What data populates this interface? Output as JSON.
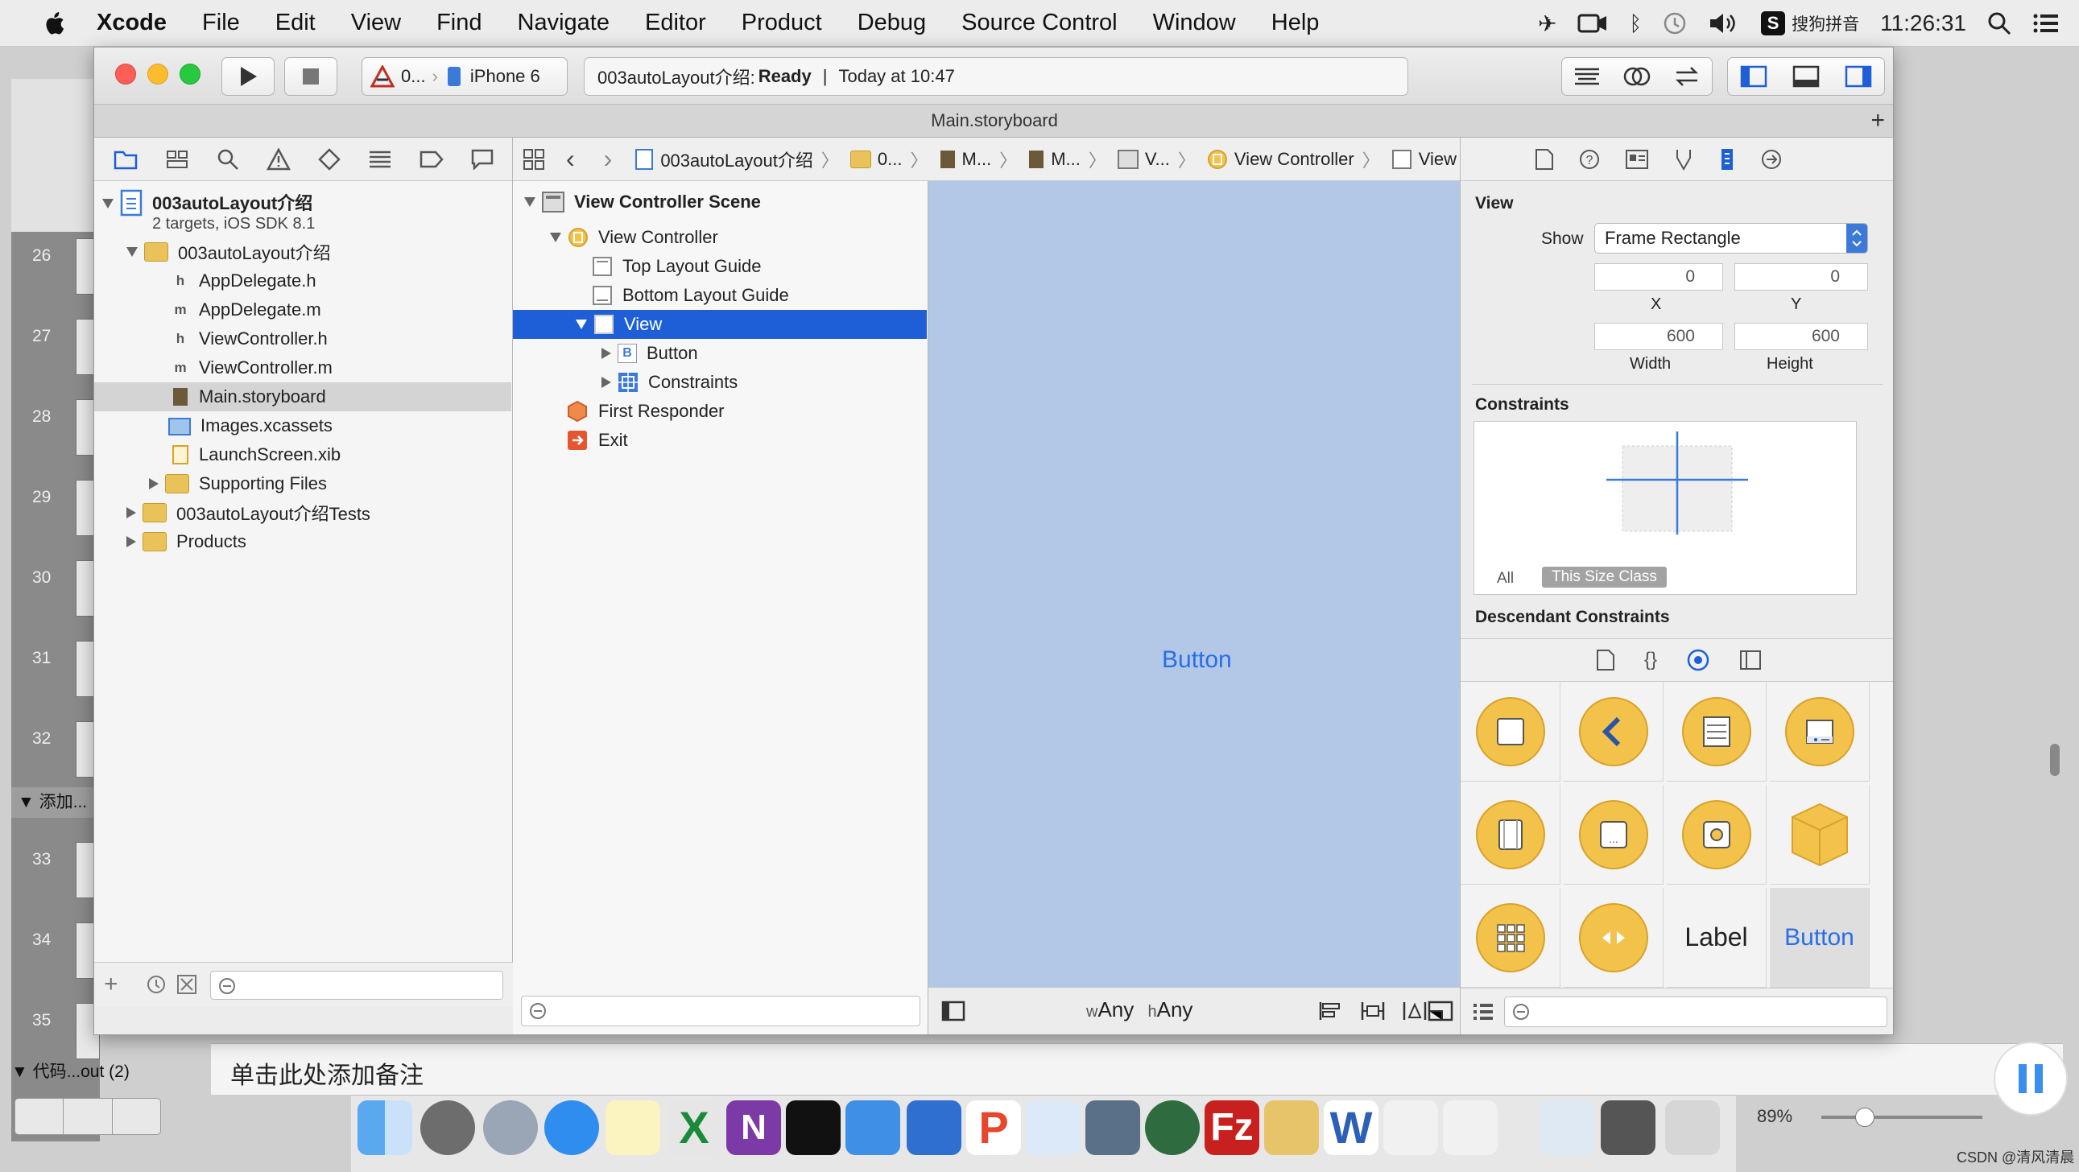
{
  "menubar": {
    "app": "Xcode",
    "items": [
      "File",
      "Edit",
      "View",
      "Find",
      "Navigate",
      "Editor",
      "Product",
      "Debug",
      "Source Control",
      "Window",
      "Help"
    ],
    "ime": "搜狗拼音",
    "clock": "11:26:31"
  },
  "toolbar": {
    "scheme_target": "0...",
    "scheme_device": "iPhone 6",
    "activity_project": "003autoLayout介绍: ",
    "activity_status": "Ready",
    "activity_sep": "|",
    "activity_time": "Today at 10:47"
  },
  "tab": {
    "title": "Main.storyboard"
  },
  "navigator": {
    "project_name": "003autoLayout介绍",
    "project_sub": "2 targets, iOS SDK 8.1",
    "group_name": "003autoLayout介绍",
    "files": [
      {
        "badge": "h",
        "name": "AppDelegate.h"
      },
      {
        "badge": "m",
        "name": "AppDelegate.m"
      },
      {
        "badge": "h",
        "name": "ViewController.h"
      },
      {
        "badge": "m",
        "name": "ViewController.m"
      },
      {
        "badge": "",
        "name": "Main.storyboard"
      },
      {
        "badge": "",
        "name": "Images.xcassets"
      },
      {
        "badge": "",
        "name": "LaunchScreen.xib"
      }
    ],
    "supporting": "Supporting Files",
    "tests": "003autoLayout介绍Tests",
    "products": "Products"
  },
  "jumpbar": [
    "003autoLayout介绍",
    "0...",
    "M...",
    "M...",
    "V...",
    "View Controller",
    "View"
  ],
  "outline": {
    "scene": "View Controller Scene",
    "vc": "View Controller",
    "top_guide": "Top Layout Guide",
    "bottom_guide": "Bottom Layout Guide",
    "view": "View",
    "button": "Button",
    "constraints": "Constraints",
    "first_responder": "First Responder",
    "exit": "Exit"
  },
  "canvas": {
    "button_label": "Button",
    "w_prefix": "w",
    "w_value": "Any",
    "h_prefix": "h",
    "h_value": "Any"
  },
  "inspector": {
    "section": "View",
    "show_label": "Show",
    "show_value": "Frame Rectangle",
    "x_value": "0",
    "y_value": "0",
    "x_label": "X",
    "y_label": "Y",
    "width_value": "600",
    "height_value": "600",
    "width_label": "Width",
    "height_label": "Height",
    "constraints_title": "Constraints",
    "seg_all": "All",
    "seg_size_class": "This Size Class",
    "descendant": "Descendant Constraints"
  },
  "library": {
    "label_item": "Label",
    "button_item": "Button"
  },
  "background_app": {
    "slide_numbers": [
      "26",
      "27",
      "28",
      "29",
      "30",
      "31",
      "32",
      "33",
      "34",
      "35"
    ],
    "section_label": "添加...",
    "section_label2": "代码...out (2)",
    "notes_placeholder": "单击此处添加备注",
    "zoom": "89%",
    "watermark": "CSDN @清风清晨"
  },
  "colors": {
    "selection": "#1e5fd8",
    "canvas": "#b3c7e6",
    "library_yellow": "#f3c24a",
    "button_blue": "#2a6ee6"
  }
}
